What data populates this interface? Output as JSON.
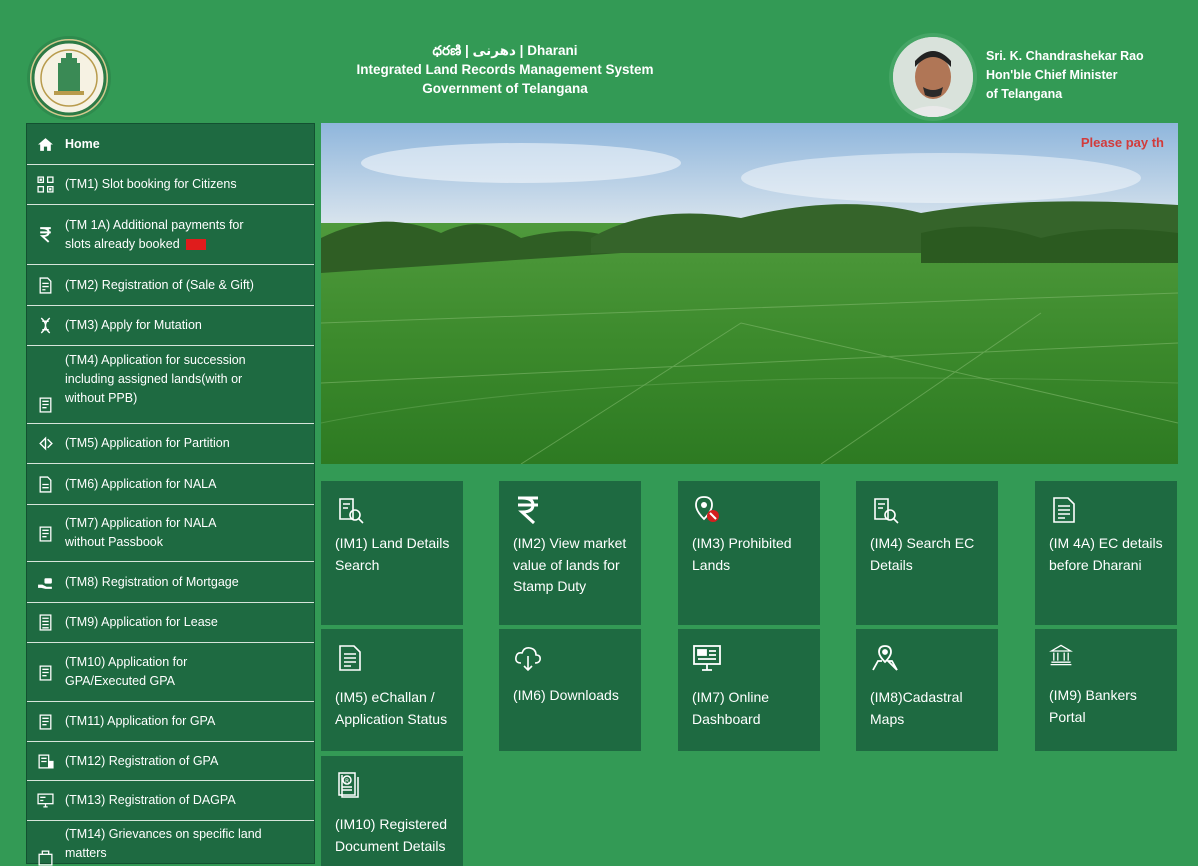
{
  "header": {
    "title_line1": "ధరణి | دھرنی | Dharani",
    "title_line2": "Integrated Land Records Management System",
    "title_line3": "Government of Telangana",
    "cm_name": "Sri. K. Chandrashekar Rao",
    "cm_title": "Hon'ble Chief Minister",
    "cm_state": "of Telangana"
  },
  "banner": {
    "marquee_text": "Please pay th"
  },
  "sidebar": {
    "items": [
      {
        "label": "Home",
        "icon": "home-icon"
      },
      {
        "label": "(TM1) Slot booking for Citizens",
        "icon": "qr-icon"
      },
      {
        "label": "(TM 1A) Additional payments for slots already booked",
        "icon": "rupee-icon",
        "badge": "new"
      },
      {
        "label": "(TM2) Registration of (Sale & Gift)",
        "icon": "document-icon"
      },
      {
        "label": "(TM3) Apply for Mutation",
        "icon": "dna-icon"
      },
      {
        "label": "(TM4) Application for succession including assigned lands(with or without PPB)",
        "icon": "passbook-icon"
      },
      {
        "label": "(TM5) Application for Partition",
        "icon": "partition-icon"
      },
      {
        "label": "(TM6) Application for NALA",
        "icon": "file-icon"
      },
      {
        "label": "(TM7) Application for NALA without Passbook",
        "icon": "passbook-icon"
      },
      {
        "label": "(TM8) Registration of Mortgage",
        "icon": "hand-money-icon"
      },
      {
        "label": "(TM9) Application for Lease",
        "icon": "ledger-icon"
      },
      {
        "label": "(TM10) Application for GPA/Executed GPA",
        "icon": "passbook-icon"
      },
      {
        "label": "(TM11) Application for GPA",
        "icon": "passbook-icon"
      },
      {
        "label": "(TM12) Registration of GPA",
        "icon": "register-icon"
      },
      {
        "label": "(TM13) Registration of DAGPA",
        "icon": "monitor-icon"
      },
      {
        "label": "(TM14) Grievances on specific land matters",
        "icon": "bag-icon"
      }
    ]
  },
  "tiles": [
    {
      "label": "(IM1) Land Details Search",
      "icon": "search-document-icon"
    },
    {
      "label": "(IM2) View market value of lands for Stamp Duty",
      "icon": "rupee-icon"
    },
    {
      "label": "(IM3) Prohibited Lands",
      "icon": "prohibited-location-icon"
    },
    {
      "label": "(IM4) Search EC Details",
      "icon": "search-document-icon"
    },
    {
      "label": "(IM 4A) EC details before Dharani",
      "icon": "document-icon"
    },
    {
      "label": "(IM5) eChallan / Application Status",
      "icon": "document-icon"
    },
    {
      "label": "(IM6) Downloads",
      "icon": "cloud-download-icon"
    },
    {
      "label": "(IM7) Online Dashboard",
      "icon": "dashboard-icon"
    },
    {
      "label": "(IM8)Cadastral Maps",
      "icon": "map-pin-icon"
    },
    {
      "label": "(IM9) Bankers Portal",
      "icon": "bank-icon"
    },
    {
      "label": "(IM10) Registered Document Details",
      "icon": "registered-document-icon"
    }
  ],
  "colors": {
    "page_bg": "#339a55",
    "panel_bg": "#1e6a41",
    "marquee": "#d23b3b",
    "badge": "#e01c1c"
  }
}
